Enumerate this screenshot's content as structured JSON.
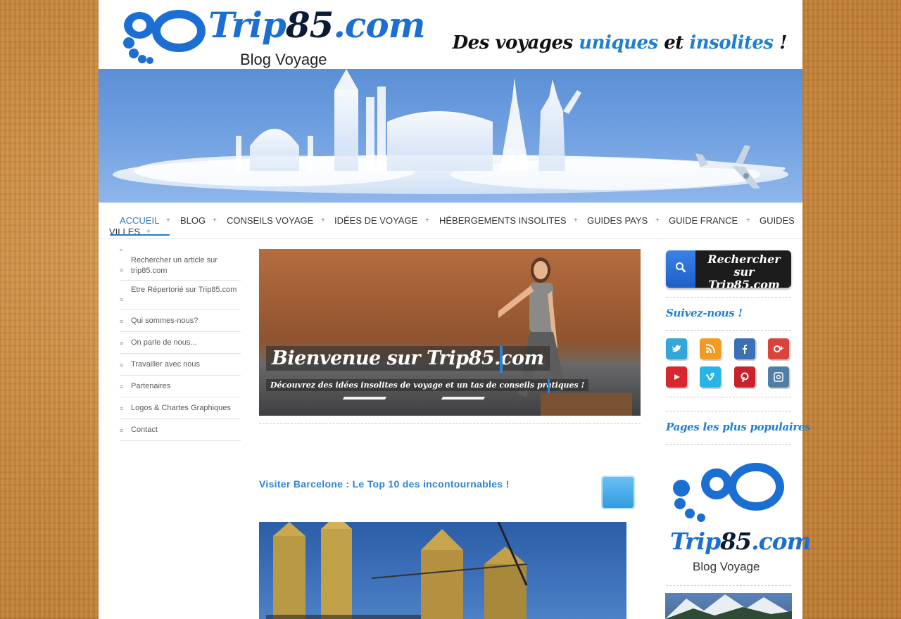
{
  "header": {
    "logo_main": "Trip",
    "logo_num": "85",
    "logo_tld": ".com",
    "logo_sub": "Blog Voyage",
    "tagline_a": "Des voyages ",
    "tagline_b": "uniques",
    "tagline_c": " et ",
    "tagline_d": "insolites",
    "tagline_e": " !"
  },
  "nav": {
    "items": [
      {
        "label": "ACCUEIL",
        "active": true
      },
      {
        "label": "BLOG"
      },
      {
        "label": "CONSEILS VOYAGE"
      },
      {
        "label": "IDÉES DE VOYAGE"
      },
      {
        "label": "HÉBERGEMENTS INSOLITES"
      },
      {
        "label": "GUIDES PAYS"
      },
      {
        "label": "GUIDE FRANCE"
      },
      {
        "label": "GUIDES"
      }
    ],
    "wrap_label": "VILLES",
    "plus": "+"
  },
  "left_menu": {
    "items": [
      "Rechercher un article sur trip85.com",
      "Etre Répertorié sur Trip85.com",
      "Qui sommes-nous?",
      "On parle de nous...",
      "Travailler avec nous",
      "Partenaires",
      "Logos & Chartes Graphiques",
      "Contact"
    ],
    "bullet": "≡",
    "top_marker": "¤"
  },
  "hero": {
    "title": "Bienvenue sur Trip85.com",
    "subtitle": "Découvrez des idées insolites de voyage et un tas de conseils pratiques !"
  },
  "post": {
    "title": "Visiter Barcelone : Le Top 10 des incontournables !"
  },
  "right": {
    "search_label": "Rechercher sur Trip85.com",
    "follow_title": "Suivez-nous !",
    "popular_title": "Pages les plus populaires",
    "social": [
      "twitter-icon",
      "rss-icon",
      "facebook-icon",
      "google-plus-icon",
      "youtube-icon",
      "vimeo-icon",
      "pinterest-icon",
      "instagram-icon"
    ],
    "logo_main": "Trip",
    "logo_num": "85",
    "logo_tld": ".com",
    "logo_sub": "Blog Voyage"
  },
  "colors": {
    "accent": "#2a86d8",
    "brand": "#1b6fd3",
    "twitter": "#35a6d9",
    "rss": "#f39a1f",
    "facebook": "#3b6fb6",
    "google": "#d8433b",
    "youtube": "#d8272e",
    "vimeo": "#27b4e6",
    "pinterest": "#c8232c",
    "instagram": "#4f7ea6"
  }
}
